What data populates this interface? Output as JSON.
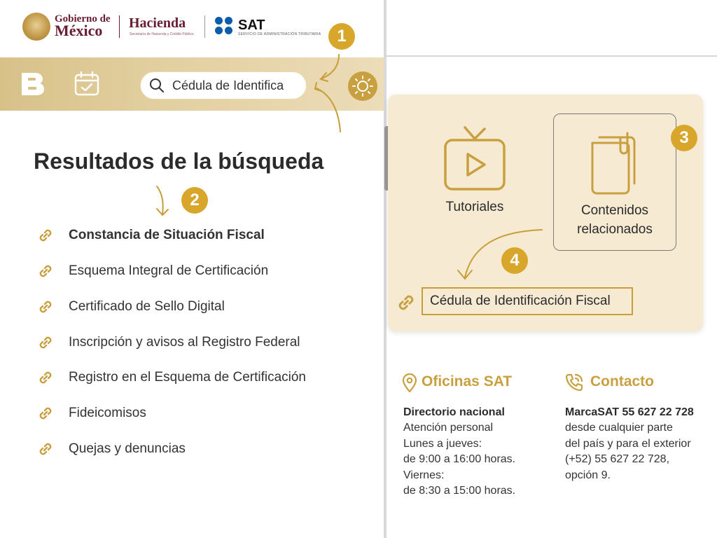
{
  "header": {
    "gobierno_line1": "Gobierno de",
    "gobierno_line2": "México",
    "hacienda_title": "Hacienda",
    "hacienda_subtitle": "Secretaría de Hacienda y Crédito Público",
    "sat_title": "SAT",
    "sat_subtitle": "SERVICIO DE ADMINISTRACIÓN TRIBUTARIA"
  },
  "badges": {
    "one": "1",
    "two": "2",
    "three": "3",
    "four": "4"
  },
  "toolbar": {
    "search_value": "Cédula de Identifica",
    "icons": [
      "brand-b-icon",
      "calendar-check-icon",
      "search-icon",
      "sun-icon"
    ]
  },
  "results": {
    "title": "Resultados de la búsqueda",
    "items": [
      {
        "label": "Constancia de Situación Fiscal"
      },
      {
        "label": "Esquema Integral de Certificación"
      },
      {
        "label": "Certificado de Sello Digital"
      },
      {
        "label": "Inscripción y avisos al Registro Federal"
      },
      {
        "label": "Registro en el Esquema de Certificación"
      },
      {
        "label": "Fideicomisos"
      },
      {
        "label": "Quejas y denuncias"
      }
    ]
  },
  "card": {
    "tutoriales": "Tutoriales",
    "contenidos_line1": "Contenidos",
    "contenidos_line2": "relacionados",
    "cedula": "Cédula de Identificación Fiscal"
  },
  "footer": {
    "oficinas": {
      "heading": "Oficinas SAT",
      "title": "Directorio nacional",
      "lines": [
        "Atención personal",
        "Lunes a jueves:",
        "de 9:00 a 16:00 horas.",
        "Viernes:",
        "de 8:30 a 15:00 horas."
      ]
    },
    "contacto": {
      "heading": "Contacto",
      "title": "MarcaSAT 55 627 22 728",
      "lines": [
        "desde cualquier parte",
        "del país y para el exterior",
        "(+52) 55 627 22 728,",
        "opción 9."
      ]
    }
  },
  "colors": {
    "gold": "#c9a040",
    "badge_gold": "#d8a62b",
    "gob_maroon": "#691c32",
    "sat_blue": "#0c5da9",
    "card_bg": "#f6ead3"
  }
}
